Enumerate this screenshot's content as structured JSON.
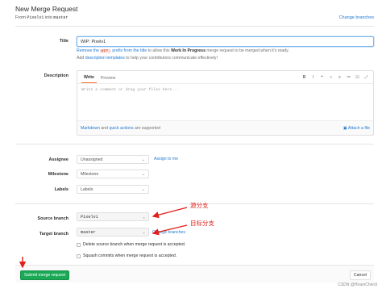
{
  "header": {
    "title": "New Merge Request",
    "from_prefix": "From",
    "source": "Pixelv1",
    "into_word": "into",
    "target": "master",
    "change_branches": "Change branches"
  },
  "title_field": {
    "label": "Title",
    "value": "WIP: Pixelv1",
    "hint_remove": "Remove the",
    "hint_code": "WIP:",
    "hint_middle": "prefix from the title",
    "hint_rest": "to allow this",
    "hint_bold": "Work In Progress",
    "hint_end": "merge request to be merged when it's ready.",
    "hint2_pre": "Add",
    "hint2_link": "description templates",
    "hint2_post": "to help your contributors communicate effectively!"
  },
  "description": {
    "label": "Description",
    "tab_write": "Write",
    "tab_preview": "Preview",
    "toolbar": [
      "B",
      "I",
      "❝",
      "‹›",
      "≡",
      "≔",
      "☑",
      "⤢"
    ],
    "placeholder": "Write a comment or drag your files here...",
    "footer_link1": "Markdown",
    "footer_and": "and",
    "footer_link2": "quick actions",
    "footer_supported": "are supported",
    "attach": "Attach a file"
  },
  "assignee": {
    "label": "Assignee",
    "value": "Unassigned",
    "assign_link": "Assign to me"
  },
  "milestone": {
    "label": "Milestone",
    "value": "Milestone"
  },
  "labels": {
    "label": "Labels",
    "value": "Labels"
  },
  "source_branch": {
    "label": "Source branch",
    "value": "Pixelv1"
  },
  "target_branch": {
    "label": "Target branch",
    "value": "master",
    "change": "Change branches"
  },
  "options": {
    "delete_source": "Delete source branch when merge request is accepted.",
    "squash": "Squash commits when merge request is accepted."
  },
  "actions": {
    "submit": "Submit merge request",
    "cancel": "Cancel"
  },
  "annotations": {
    "source": "源分支",
    "target": "目标分支"
  },
  "watermark": "CSDN @HiramChen9",
  "colors": {
    "accent": "#1f78d1",
    "submit": "#1aaa55",
    "annotation": "#e0201a"
  }
}
